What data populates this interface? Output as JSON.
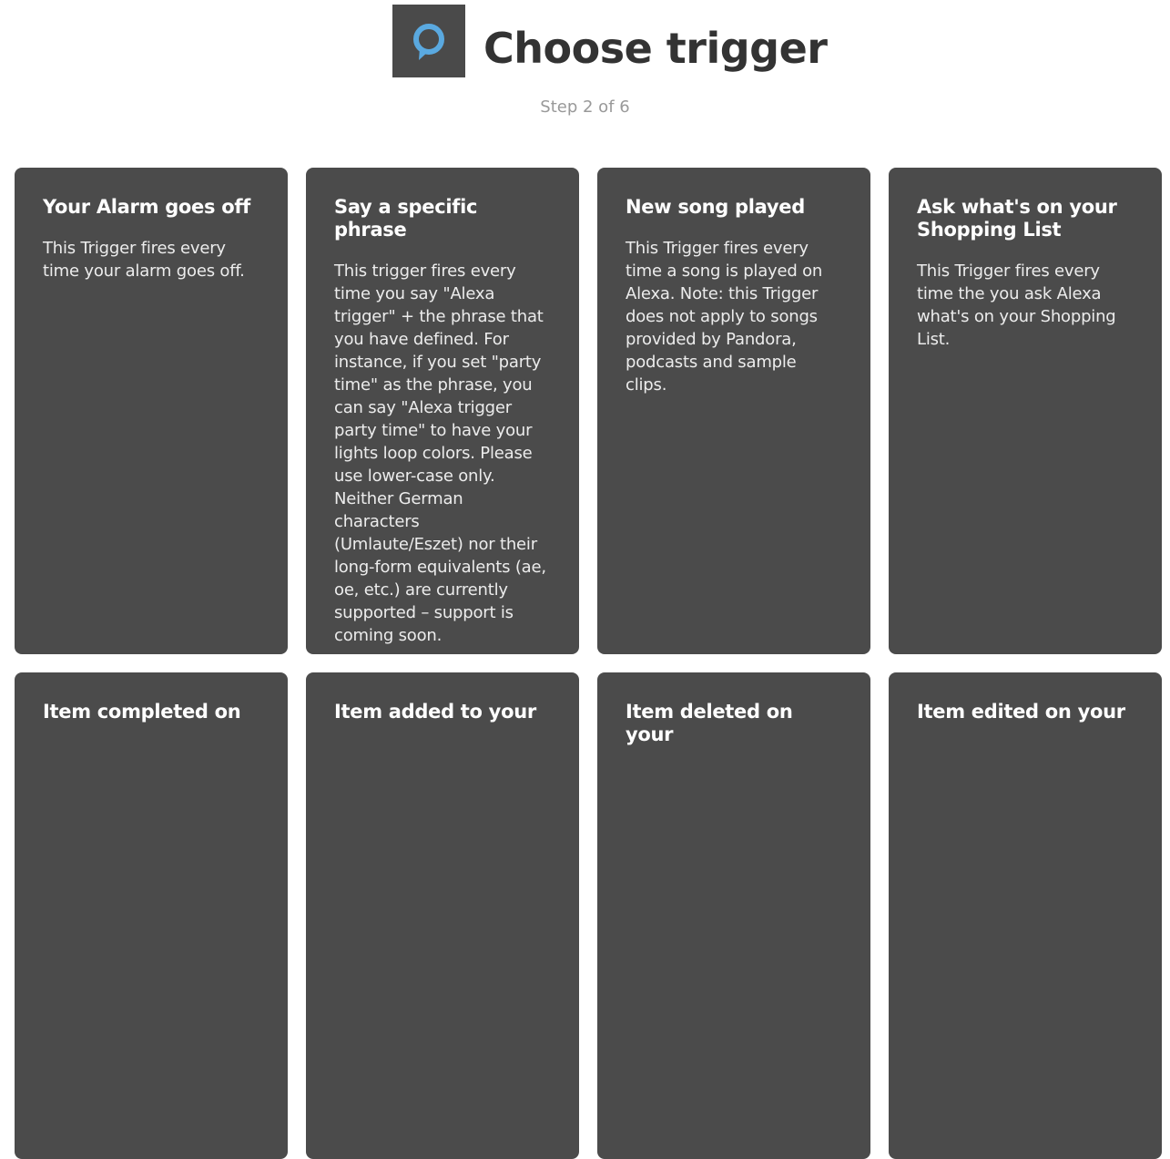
{
  "header": {
    "logo_icon": "alexa-icon",
    "title": "Choose trigger",
    "step": "Step 2 of 6"
  },
  "colors": {
    "card_background": "#4b4b4b",
    "logo_background": "#4a4a4a",
    "alexa_blue": "#5aa9e0"
  },
  "triggers": [
    {
      "title": "Your Alarm goes off",
      "description": "This Trigger fires every time your alarm goes off."
    },
    {
      "title": "Say a specific phrase",
      "description": "This trigger fires every time you say \"Alexa trigger\" + the phrase that you have defined. For instance, if you set \"party time\" as the phrase, you can say \"Alexa trigger party time\" to have your lights loop colors. Please use lower-case only. Neither German characters (Umlaute/Eszet) nor their long-form equivalents (ae, oe, etc.) are currently supported – support is coming soon."
    },
    {
      "title": "New song played",
      "description": "This Trigger fires every time a song is played on Alexa. Note: this Trigger does not apply to songs provided by Pandora, podcasts and sample clips."
    },
    {
      "title": "Ask what's on your Shopping List",
      "description": "This Trigger fires every time the you ask Alexa what's on your Shopping List."
    },
    {
      "title": "Item completed on",
      "description": ""
    },
    {
      "title": "Item added to your",
      "description": ""
    },
    {
      "title": "Item deleted on your",
      "description": ""
    },
    {
      "title": "Item edited on your",
      "description": ""
    }
  ]
}
